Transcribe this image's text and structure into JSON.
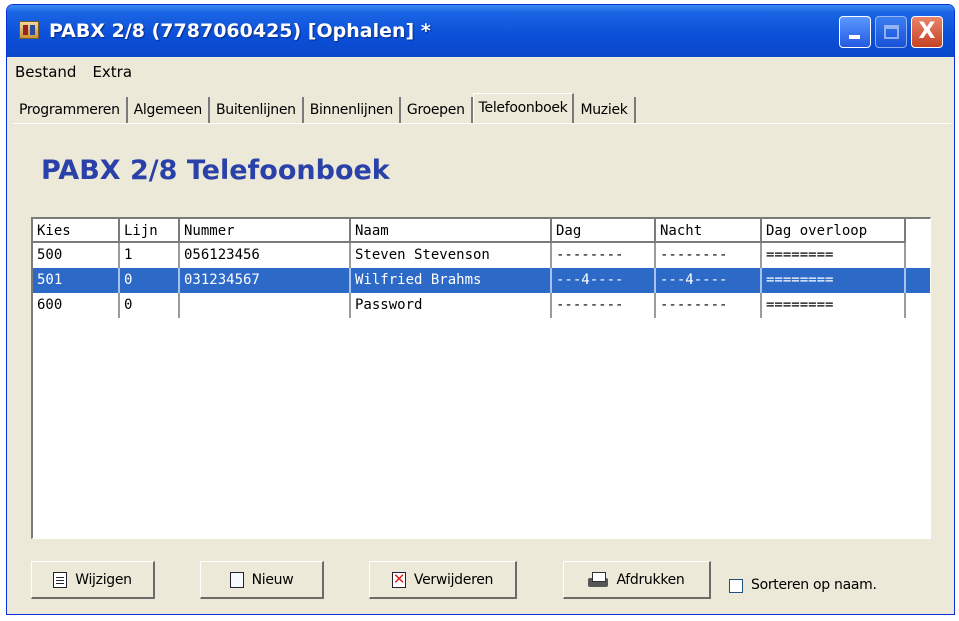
{
  "window": {
    "title": "PABX 2/8 (7787060425) [Ophalen] *",
    "close_glyph": "X"
  },
  "menu": [
    "Bestand",
    "Extra"
  ],
  "tabs": [
    "Programmeren",
    "Algemeen",
    "Buitenlijnen",
    "Binnenlijnen",
    "Groepen",
    "Telefoonboek",
    "Muziek"
  ],
  "active_tab": "Telefoonboek",
  "heading": "PABX 2/8 Telefoonboek",
  "table": {
    "columns": [
      "Kies",
      "Lijn",
      "Nummer",
      "Naam",
      "Dag",
      "Nacht",
      "Dag overloop"
    ],
    "rows": [
      [
        "500",
        "1",
        "056123456",
        "Steven Stevenson",
        "--------",
        "--------",
        "========"
      ],
      [
        "501",
        "0",
        "031234567",
        "Wilfried Brahms",
        "---4----",
        "---4----",
        "========"
      ],
      [
        "600",
        "0",
        "",
        "Password",
        "--------",
        "--------",
        "========"
      ]
    ],
    "selected_row": 1
  },
  "buttons": {
    "edit": "Wijzigen",
    "new": "Nieuw",
    "delete": "Verwijderen",
    "print": "Afdrukken"
  },
  "sort_checkbox": {
    "label": "Sorteren op naam.",
    "checked": false
  },
  "colors": {
    "titlebar": "#0b4fd8",
    "heading": "#2941a8",
    "selection": "#2d69c7",
    "window_bg": "#ece9d8"
  }
}
